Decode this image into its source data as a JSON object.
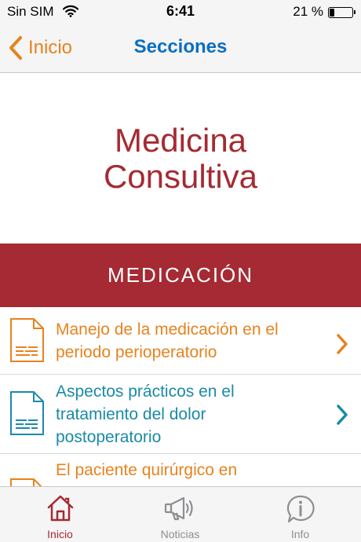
{
  "status_bar": {
    "carrier": "Sin SIM",
    "time": "6:41",
    "battery_percent": "21 %",
    "battery_level": 0.21
  },
  "nav": {
    "back_label": "Inicio",
    "title": "Secciones"
  },
  "hero": {
    "title": "Medicina Consultiva"
  },
  "section": {
    "title": "MEDICACIÓN"
  },
  "items": [
    {
      "text": "Manejo de la medicación en el periodo perioperatorio",
      "color": "#e8821e"
    },
    {
      "text": "Aspectos prácticos en el tratamiento del dolor postoperatorio",
      "color": "#1a8aa8"
    },
    {
      "text": "El paciente quirúrgico en",
      "color": "#e8821e"
    }
  ],
  "tabs": [
    {
      "label": "Inicio",
      "icon": "home-icon",
      "active": true
    },
    {
      "label": "Noticias",
      "icon": "megaphone-icon",
      "active": false
    },
    {
      "label": "Info",
      "icon": "info-icon",
      "active": false
    }
  ],
  "colors": {
    "brand_red": "#a52a33",
    "orange": "#e8821e",
    "teal": "#1a8aa8",
    "nav_blue": "#0a6fc2",
    "inactive_gray": "#8e8e93"
  }
}
